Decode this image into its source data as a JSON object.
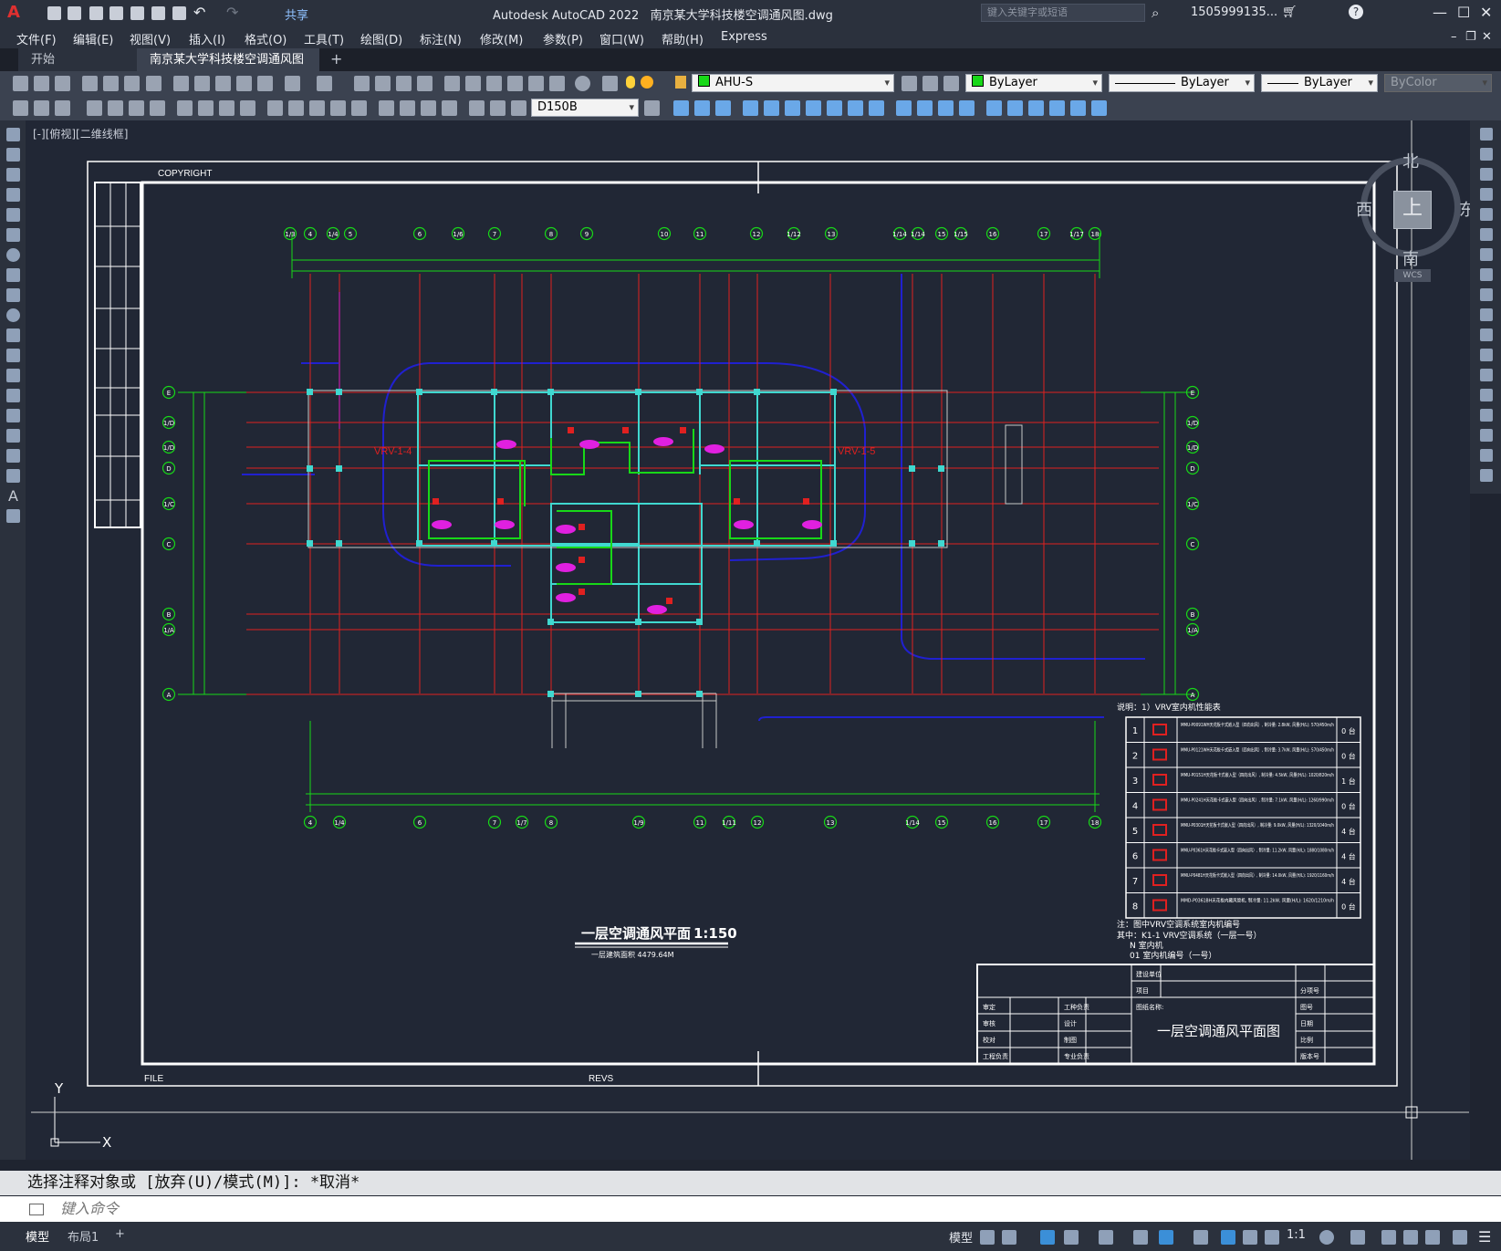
{
  "titlebar": {
    "app_name": "Autodesk AutoCAD 2022",
    "file_name": "南京某大学科技楼空调通风图.dwg",
    "share": "共享",
    "search_placeholder": "键入关键字或短语",
    "user": "1505999135...",
    "help": "?"
  },
  "menu": [
    "文件(F)",
    "编辑(E)",
    "视图(V)",
    "插入(I)",
    "格式(O)",
    "工具(T)",
    "绘图(D)",
    "标注(N)",
    "修改(M)",
    "参数(P)",
    "窗口(W)",
    "帮助(H)",
    "Express"
  ],
  "tabs": {
    "start": "开始",
    "doc": "南京某大学科技楼空调通风图*",
    "close": "×",
    "add": "+"
  },
  "toolbar": {
    "layer": "AHU-S",
    "color": "ByLayer",
    "linetype": "ByLayer",
    "lineweight": "ByLayer",
    "plotstyle": "ByColor",
    "dimstyle": "D150B"
  },
  "viewport": {
    "label": "[-][俯视][二维线框]"
  },
  "viewcube": {
    "north": "北",
    "south": "南",
    "east": "东",
    "west": "西",
    "top": "上",
    "wcs": "WCS"
  },
  "drawing": {
    "copyright": "COPYRIGHT",
    "file": "FILE",
    "revs": "REVS",
    "plan_title": "一层空调通风平面",
    "scale": "1:150",
    "area": "一层建筑面积  4479.64M",
    "legend_title": "说明：1）VRV室内机性能表",
    "legend_rows": [
      {
        "no": "1",
        "model": "MMU-P0091WH天花板卡式嵌入型（四向出风）, 制冷量: 2.8kW, 风量(H/L): 570/450m/h",
        "qty": "0 台"
      },
      {
        "no": "2",
        "model": "MMU-P0121WH天花板卡式嵌入型（四向出风）, 制冷量: 3.7kW, 风量(H/L): 570/450m/h",
        "qty": "0 台"
      },
      {
        "no": "3",
        "model": "MMU-P0151H天花板卡式嵌入型（四向出风）, 制冷量: 4.5kW, 风量(H/L): 1020/820m/h",
        "qty": "1 台"
      },
      {
        "no": "4",
        "model": "MMU-P0241H天花板卡式嵌入型（四向出风）, 制冷量: 7.1kW, 风量(H/L): 1260/990m/h",
        "qty": "0 台"
      },
      {
        "no": "5",
        "model": "MMU-P0301H天花板卡式嵌入型（四向出风）, 制冷量: 9.0kW, 风量(H/L): 1320/1040m/h",
        "qty": "4 台"
      },
      {
        "no": "6",
        "model": "MMU-P0361H天花板卡式嵌入型（四向出风）, 制冷量: 11.2kW, 风量(H/L): 1880/1080m/h",
        "qty": "4 台"
      },
      {
        "no": "7",
        "model": "MMU-P0481H天花板卡式嵌入型（四向出风）, 制冷量: 14.0kW, 风量(H/L): 1920/1160m/h",
        "qty": "4 台"
      },
      {
        "no": "8",
        "model": "MMD-P0361BH天花板内藏风管机, 制冷量: 11.2kW, 风量(H/L): 1620/1210m/h",
        "qty": "0 台"
      }
    ],
    "note_1": "注：图中VRV空调系统室内机编号",
    "note_2": "其中：K1-1  VRV空调系统（一层一号）",
    "note_3": "N      室内机",
    "note_4": "01     室内机编号（一号）",
    "titleblock_name": "一层空调通风平面图",
    "tb_labels": [
      "建设单位",
      "项目",
      "审定",
      "审核",
      "校对",
      "设计",
      "制图",
      "工程负责",
      "工种负责",
      "专业负责",
      "图纸名称:",
      "分项号",
      "图号",
      "日期",
      "比例",
      "版本号"
    ],
    "vrv_left": "VRV-1-4",
    "vrv_right": "VRV-1-5",
    "axes_top": [
      "1/3",
      "4",
      "1/4",
      "5",
      "6",
      "1/6",
      "7",
      "8",
      "9",
      "10",
      "11",
      "12",
      "1/12",
      "13",
      "1/14",
      "1/14",
      "15",
      "1/15",
      "16",
      "17",
      "1/17",
      "18"
    ],
    "axes_bottom": [
      "4",
      "1/4",
      "6",
      "7",
      "1/7",
      "8",
      "1/9",
      "11",
      "1/11",
      "12",
      "13",
      "1/14",
      "15",
      "16",
      "17",
      "18"
    ],
    "axes_left": [
      "E",
      "1/D",
      "1/D",
      "D",
      "1/C",
      "C",
      "B",
      "1/A",
      "A"
    ],
    "axes_right": [
      "E",
      "1/D",
      "1/D",
      "D",
      "1/C",
      "C",
      "B",
      "1/A",
      "A"
    ],
    "ucs_x": "X",
    "ucs_y": "Y"
  },
  "command": {
    "history": "选择注释对象或 [放弃(U)/模式(M)]: *取消*",
    "input_placeholder": "键入命令"
  },
  "status": {
    "model_tab": "模型",
    "layout_tab": "布局1",
    "add": "+",
    "model": "模型",
    "scale": "1:1"
  },
  "colors": {
    "grid_red": "#e02020",
    "dim_green": "#18d818",
    "wall_cyan": "#40d8d0",
    "duct_blue": "#2020d0",
    "unit_magenta": "#e020e0",
    "frame_white": "#ffffff"
  }
}
